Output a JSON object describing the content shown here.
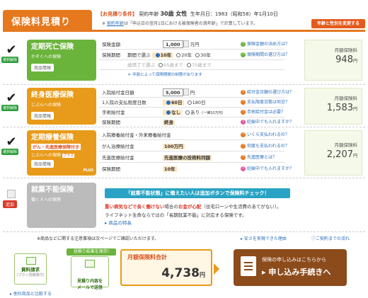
{
  "header": {
    "title": "保険料見積り",
    "cond_label": "【お見積り条件】",
    "cond_contract_age": "契約年齢",
    "cond_age_value": "30歳 女性",
    "cond_birth": "生年月日：1983（昭和58）年1月10日",
    "cond_note_prefix": "※",
    "cond_note_link": "契約年齢",
    "cond_note_rest": "は「申込日の翌月1日における被保険者の満年齢」で計算しています。",
    "change_button": "年齢と性別を変更する"
  },
  "plans": [
    {
      "name": "定期死亡保険",
      "sub": "かぞくへの保険",
      "info": "商品情報",
      "check": "✔",
      "tag": "選択解除",
      "rows": [
        {
          "k": "保険金額",
          "v": "1,000",
          "unit": "万円"
        },
        {
          "k": "保険期間",
          "period_label": "期間で選ぶ",
          "opts": [
            "10年",
            "20年",
            "30年"
          ]
        },
        {
          "k": "",
          "period_label": "歳満了で選ぶ",
          "opts": [
            "65歳まで",
            "70歳まで"
          ]
        },
        {
          "k": "",
          "note": "＊ 年齢によって保険期間の制限があります"
        }
      ],
      "helps": [
        "保険金額の決め方は？",
        "保険期間の選び方は？"
      ],
      "price_label": "月額保険料",
      "price": "948",
      "yen": "円"
    },
    {
      "name": "終身医療保険",
      "sub": "じぶんへの保険",
      "info": "商品情報",
      "check": "✔",
      "tag": "選択解除",
      "rows": [
        {
          "k": "入院給付金日額",
          "v": "5,000",
          "unit": "円"
        },
        {
          "k": "1入院の支払限度日数",
          "opts": [
            "60日",
            "180日"
          ]
        },
        {
          "k": "手術給付金",
          "opts": [
            "なし",
            "あり"
          ],
          "extra": "（一律10万円）"
        },
        {
          "k": "保険期間",
          "v": "終身"
        }
      ],
      "helps": [
        "給付金日額の選び方は？",
        "支払限度日数は何日？",
        "手術給付金は必要？",
        "妊娠中でも入れますか？"
      ],
      "price_label": "月額保険料",
      "price": "1,583",
      "yen": "円"
    },
    {
      "name": "定期療養保険",
      "badge": "がん・先進医療保障付き",
      "sub": "じぶんへの保険",
      "plus_tag": "プラス",
      "plus_logo": "PLUS",
      "info": "商品情報",
      "check": "✔",
      "tag": "選択解除",
      "rows": [
        {
          "k": "入院療養給付金・外来療養給付金"
        },
        {
          "k": "がん治療給付金",
          "v": "100万円"
        },
        {
          "k": "先進医療給付金",
          "v": "先進医療の技術料同額"
        },
        {
          "k": "保険期間",
          "v": "10年"
        }
      ],
      "helps": [
        "いくら支払われるの？",
        "何度も支払われるの？",
        "先進医療とは？",
        "妊娠中でも入れますか？"
      ],
      "price_label": "月額保険料",
      "price": "2,207",
      "yen": "円"
    }
  ],
  "disability": {
    "name": "就業不能保険",
    "sub": "働く人への保険",
    "tag": "追加",
    "banner": "「就業不能状態」に備えたい人は追加ボタンで保険料チェック！",
    "desc_red1": "重い病気などで長く働けない",
    "desc_mid": "場合の",
    "desc_red2": "お金が心配",
    "desc_rest": "（住宅ローンや生活費のあてがない）。",
    "desc_line2": "ライフネット生命ならではの「長期就業不能」に対応する保険です。",
    "link": "商品の特長"
  },
  "footer": {
    "note_left": "※商品などに関する注意事項は次ページでご確認いただけます。",
    "note_link1": "安さを実現できた理由",
    "note_link2": "ご契約までの流れ",
    "save_tag": "見積り結果を保存!",
    "doc_btn": "資料請求",
    "doc_sub": "(プラン見積書付)",
    "mail_btn": "見積り内容を\nメールで送信",
    "total_label": "月額保険料合計",
    "total_value": "4,738",
    "yen": "円",
    "apply_top": "保険の申し込みはこちらから",
    "apply_main": "▸ 申し込み手続きへ",
    "compare": "他社商品と比較する"
  }
}
